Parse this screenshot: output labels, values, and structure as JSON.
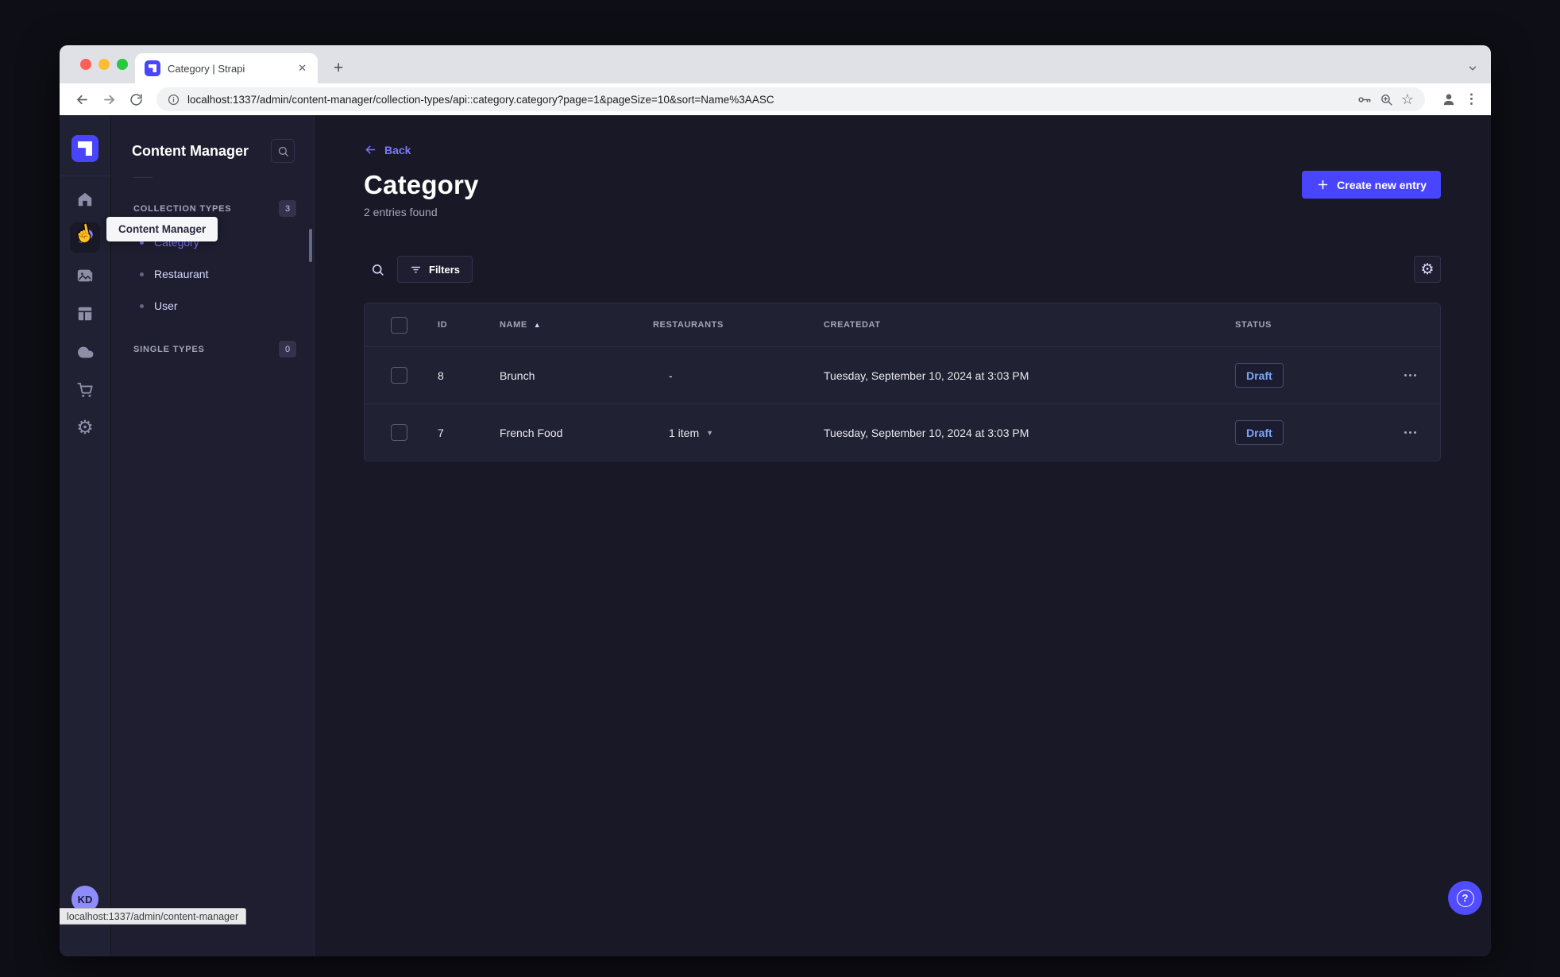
{
  "colors": {
    "primary": "#4945ff",
    "accent": "#7b79ff",
    "draft_text": "#7ba3f8",
    "page_bg": "#181826",
    "card_bg": "#212134"
  },
  "browser": {
    "tab_title": "Category | Strapi",
    "url": "localhost:1337/admin/content-manager/collection-types/api::category.category?page=1&pageSize=10&sort=Name%3AASC",
    "status_bubble": "localhost:1337/admin/content-manager"
  },
  "icons": {
    "close_glyph": "✕",
    "plus_glyph": "+",
    "star_glyph": "☆",
    "gear_glyph": "⚙",
    "menu_dots_glyph": "⋮",
    "sort_asc_glyph": "▲",
    "caret_down_glyph": "▼",
    "hand_cursor_glyph": "☝",
    "question_glyph": "?"
  },
  "rail": {
    "tooltip": "Content Manager",
    "avatar_initials": "KD"
  },
  "subnav": {
    "title": "Content Manager",
    "sections": [
      {
        "label": "COLLECTION TYPES",
        "badge": "3",
        "items": [
          {
            "label": "Category"
          },
          {
            "label": "Restaurant"
          },
          {
            "label": "User"
          }
        ]
      },
      {
        "label": "SINGLE TYPES",
        "badge": "0",
        "items": []
      }
    ]
  },
  "main": {
    "back_label": "Back",
    "title": "Category",
    "subtitle": "2 entries found",
    "create_button_label": "Create new entry",
    "filters_button_label": "Filters"
  },
  "table": {
    "headers": {
      "id": "ID",
      "name": "NAME",
      "restaurants": "RESTAURANTS",
      "createdat": "CREATEDAT",
      "status": "STATUS"
    },
    "rows": [
      {
        "id": "8",
        "name": "Brunch",
        "restaurants": "-",
        "createdat": "Tuesday, September 10, 2024 at 3:03 PM",
        "status": "Draft"
      },
      {
        "id": "7",
        "name": "French Food",
        "restaurants": "1 item",
        "createdat": "Tuesday, September 10, 2024 at 3:03 PM",
        "status": "Draft"
      }
    ]
  }
}
